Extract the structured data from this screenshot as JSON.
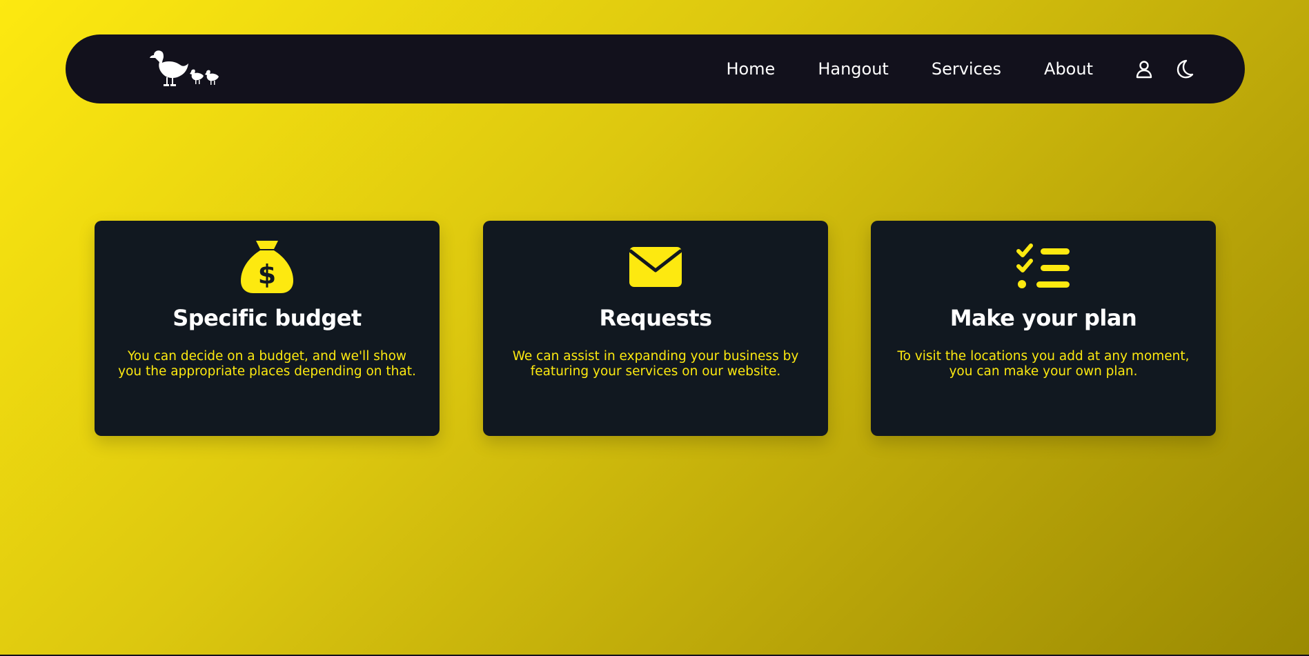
{
  "nav": {
    "logo_alt": "ducks-logo",
    "links": [
      "Home",
      "Hangout",
      "Services",
      "About"
    ],
    "icons": [
      "user-icon",
      "moon-icon"
    ]
  },
  "cards": [
    {
      "icon": "money-bag-icon",
      "title": "Specific budget",
      "description": "You can decide on a budget, and we'll show you the appropriate places depending on that."
    },
    {
      "icon": "envelope-icon",
      "title": "Requests",
      "description": "We can assist in expanding your business by featuring your services on our website."
    },
    {
      "icon": "checklist-icon",
      "title": "Make your plan",
      "description": "To visit the locations you add at any moment, you can make your own plan."
    }
  ],
  "colors": {
    "accent": "#fde910",
    "nav_bg": "#12111c",
    "card_bg": "#111820",
    "text_light": "#ffffff"
  }
}
